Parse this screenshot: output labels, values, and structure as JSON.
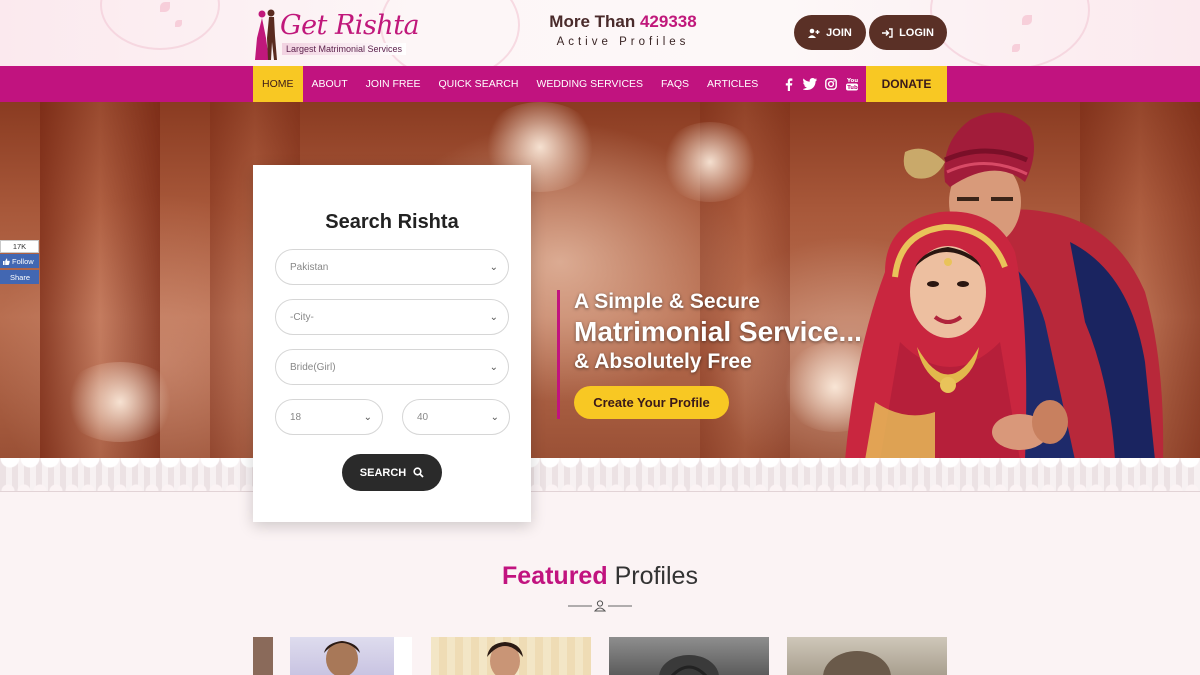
{
  "header": {
    "logo_title": "Get Rishta",
    "logo_tagline": "Largest Matrimonial Services",
    "profiles_prefix": "More Than",
    "profiles_count": "429338",
    "profiles_label": "Active Profiles",
    "join_label": "JOIN",
    "login_label": "LOGIN"
  },
  "nav": {
    "items": [
      "HOME",
      "ABOUT",
      "JOIN FREE",
      "QUICK SEARCH",
      "WEDDING SERVICES",
      "FAQS",
      "ARTICLES"
    ],
    "active": "HOME",
    "socials": [
      "facebook-icon",
      "twitter-icon",
      "instagram-icon",
      "youtube-icon"
    ],
    "donate_label": "DONATE"
  },
  "search": {
    "title": "Search Rishta",
    "country_value": "Pakistan",
    "city_value": "-City-",
    "gender_value": "Bride(Girl)",
    "age_from": "18",
    "age_to": "40",
    "button_label": "SEARCH"
  },
  "hero": {
    "line1": "A Simple & Secure",
    "line2": "Matrimonial Service...",
    "line3": "& Absolutely Free",
    "cta_label": "Create Your Profile"
  },
  "facebook_widget": {
    "count": "17K",
    "follow_label": "Follow",
    "share_label": "Share"
  },
  "featured": {
    "highlight": "Featured",
    "rest": "Profiles"
  },
  "colors": {
    "brand_magenta": "#c1137f",
    "accent_yellow": "#f8c823",
    "brown_button": "#5a3026",
    "dark_button": "#2a2a2a"
  }
}
